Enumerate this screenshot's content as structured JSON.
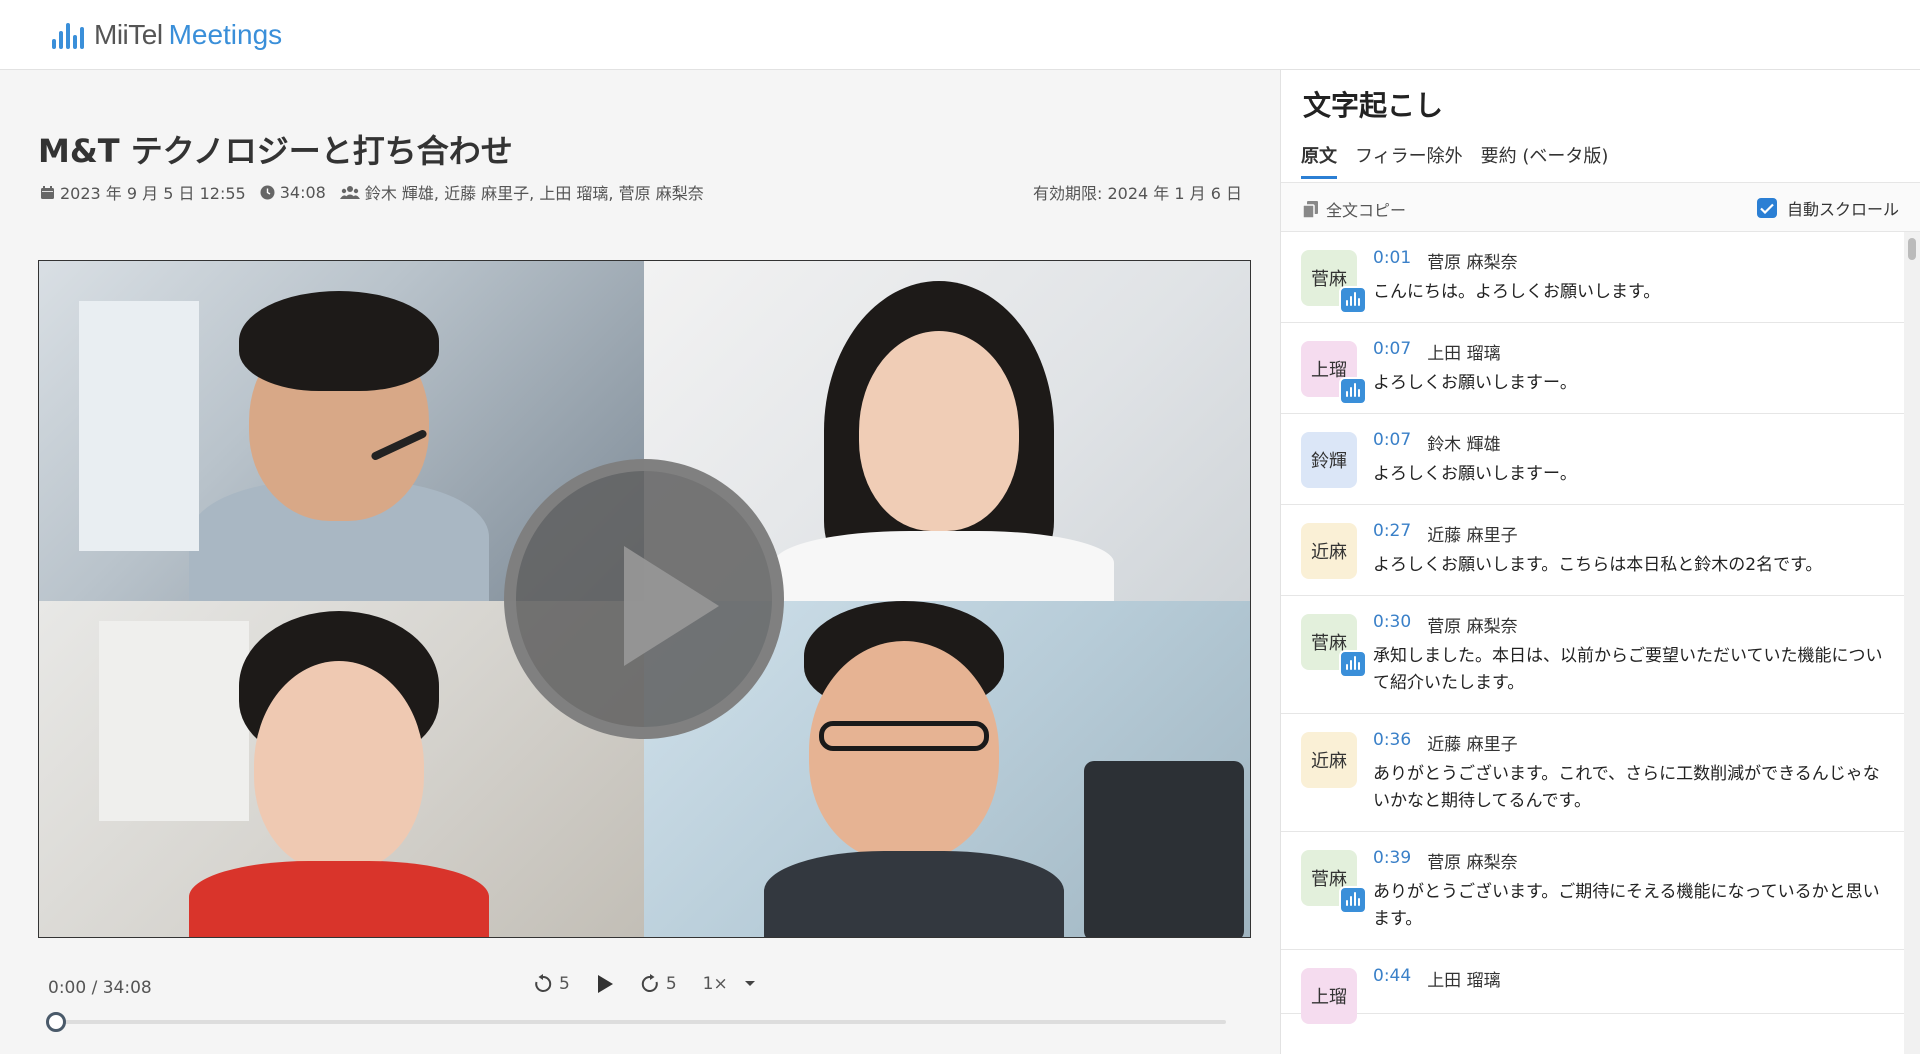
{
  "app": {
    "logo_text_a": "MiiTel",
    "logo_text_b": "Meetings",
    "logo_color": "#3a8fd9"
  },
  "meeting": {
    "title": "M&T テクノロジーと打ち合わせ",
    "date": "2023 年 9 月 5 日 12:55",
    "duration": "34:08",
    "participants": "鈴木 輝雄, 近藤 麻里子, 上田 瑠璃, 菅原 麻梨奈",
    "expiry": "有効期限: 2024 年 1 月 6 日"
  },
  "player": {
    "time": "0:00 / 34:08",
    "rewind_label": "5",
    "forward_label": "5",
    "speed_label": "1×",
    "progress": 0.0
  },
  "transcript": {
    "title": "文字起こし",
    "tabs": [
      {
        "label": "原文",
        "active": true
      },
      {
        "label": "フィラー除外",
        "active": false
      },
      {
        "label": "要約 (ベータ版)",
        "active": false
      }
    ],
    "copy_label": "全文コピー",
    "autoscroll_label": "自動スクロール",
    "autoscroll_checked": true,
    "items": [
      {
        "avatar": "菅麻",
        "avatar_color": "#e3f0dc",
        "voice": true,
        "time": "0:01",
        "speaker": "菅原 麻梨奈",
        "text": "こんにちは。よろしくお願いします。"
      },
      {
        "avatar": "上瑠",
        "avatar_color": "#f5dcef",
        "voice": true,
        "time": "0:07",
        "speaker": "上田 瑠璃",
        "text": "よろしくお願いしますー。"
      },
      {
        "avatar": "鈴輝",
        "avatar_color": "#dbe6f7",
        "voice": false,
        "time": "0:07",
        "speaker": "鈴木 輝雄",
        "text": "よろしくお願いしますー。"
      },
      {
        "avatar": "近麻",
        "avatar_color": "#faf0d6",
        "voice": false,
        "time": "0:27",
        "speaker": "近藤 麻里子",
        "text": "よろしくお願いします。こちらは本日私と鈴木の2名です。"
      },
      {
        "avatar": "菅麻",
        "avatar_color": "#e3f0dc",
        "voice": true,
        "time": "0:30",
        "speaker": "菅原 麻梨奈",
        "text": "承知しました。本日は、以前からご要望いただいていた機能について紹介いたします。"
      },
      {
        "avatar": "近麻",
        "avatar_color": "#faf0d6",
        "voice": false,
        "time": "0:36",
        "speaker": "近藤 麻里子",
        "text": "ありがとうございます。これで、さらに工数削減ができるんじゃないかなと期待してるんです。"
      },
      {
        "avatar": "菅麻",
        "avatar_color": "#e3f0dc",
        "voice": true,
        "time": "0:39",
        "speaker": "菅原 麻梨奈",
        "text": "ありがとうございます。ご期待にそえる機能になっているかと思います。"
      },
      {
        "avatar": "上瑠",
        "avatar_color": "#f5dcef",
        "voice": false,
        "time": "0:44",
        "speaker": "上田 瑠璃",
        "text": ""
      }
    ]
  }
}
